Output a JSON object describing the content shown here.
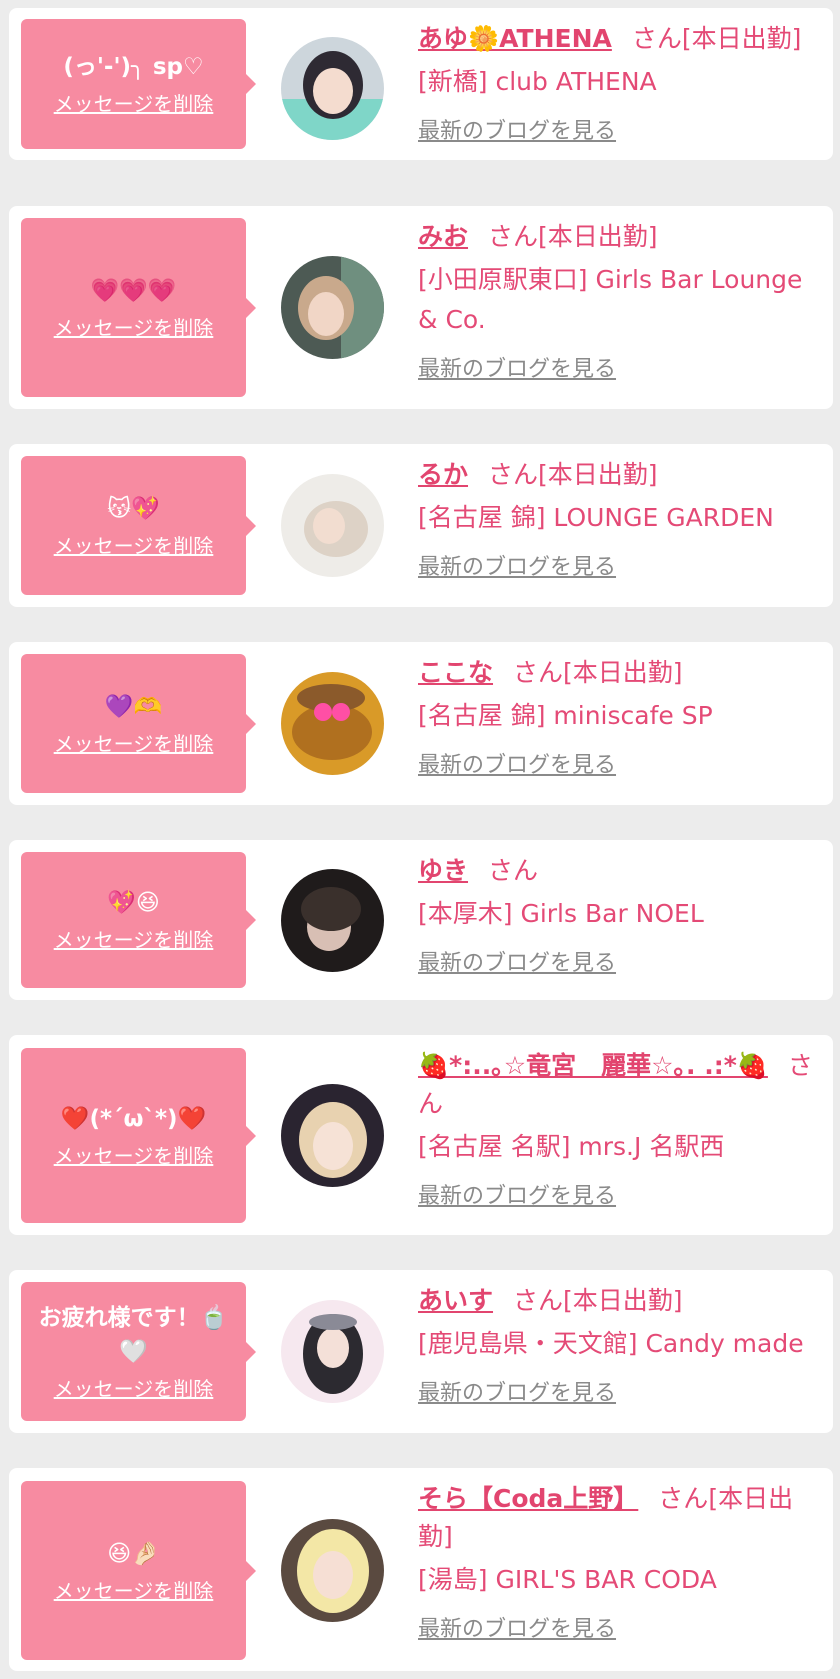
{
  "delete_label": "メッセージを削除",
  "blog_label": "最新のブログを見る",
  "honorific": "さん",
  "colors": {
    "bubble": "#f78ba1",
    "name": "#e2456f",
    "text": "#e44a76",
    "link_gray": "#8a8a8a",
    "page_bg": "#ececec"
  },
  "entries": [
    {
      "message": "(っ'-')╮ sp♡",
      "name": "あゆ🌼ATHENA",
      "status": "[本日出勤]",
      "store": "[新橋] club ATHENA",
      "avatar": "avatar-photo"
    },
    {
      "message": "💗💗💗",
      "name": "みお",
      "status": "[本日出勤]",
      "store": "[小田原駅東口] Girls Bar Lounge & Co.",
      "avatar": "avatar-photo"
    },
    {
      "message": "😽💖",
      "name": "るか",
      "status": "[本日出勤]",
      "store": "[名古屋 錦] LOUNGE GARDEN",
      "avatar": "avatar-photo"
    },
    {
      "message": "💜🫶",
      "name": "ここな",
      "status": "[本日出勤]",
      "store": "[名古屋 錦] miniscafe SP",
      "avatar": "avatar-photo"
    },
    {
      "message": "💖😆",
      "name": "ゆき",
      "status": "",
      "store": "[本厚木] Girls Bar NOEL",
      "avatar": "avatar-photo"
    },
    {
      "message": "❤️(*´ω`*)❤️",
      "name": "🍓*:..｡☆竜宮　麗華☆｡. .:*🍓",
      "status": "",
      "store": "[名古屋 名駅] mrs.J 名駅西",
      "avatar": "avatar-photo"
    },
    {
      "message": "お疲れ様です！🍵🤍",
      "name": "あいす",
      "status": "[本日出勤]",
      "store": "[鹿児島県・天文館] Candy made",
      "avatar": "avatar-photo"
    },
    {
      "message": "😆🤌🏻",
      "name": "そら【Coda上野】",
      "status": "[本日出勤]",
      "store": "[湯島] GIRL'S BAR CODA",
      "avatar": "avatar-photo"
    }
  ]
}
